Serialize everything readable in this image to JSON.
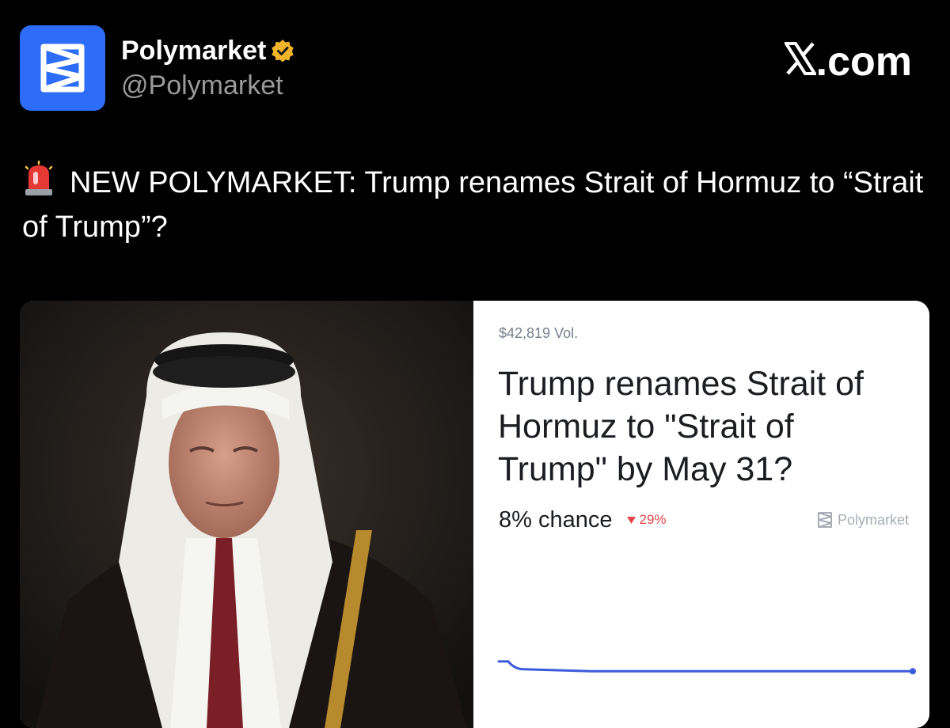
{
  "author": {
    "display_name": "Polymarket",
    "handle": "@Polymarket",
    "verified_icon": "verified-badge-icon"
  },
  "site_label": ".com",
  "post": {
    "text": "NEW POLYMARKET: Trump renames Strait of Hormuz to “Strait of Trump”?"
  },
  "card": {
    "volume": "$42,819 Vol.",
    "market_title": "Trump renames Strait of Hormuz to \"Strait of Trump\" by May 31?",
    "chance": "8% chance",
    "change": "29%",
    "brand": "Polymarket"
  },
  "colors": {
    "brand_blue": "#2d6cf6",
    "verified_gold": "#f0b429",
    "down_red": "#e5484d",
    "line_blue": "#3b5bdb"
  },
  "chart_data": {
    "type": "line",
    "series": [
      {
        "values": [
          13,
          9,
          8,
          8,
          8,
          8,
          8,
          8,
          8,
          8
        ]
      }
    ],
    "ylim": [
      0,
      60
    ],
    "grid": false
  }
}
